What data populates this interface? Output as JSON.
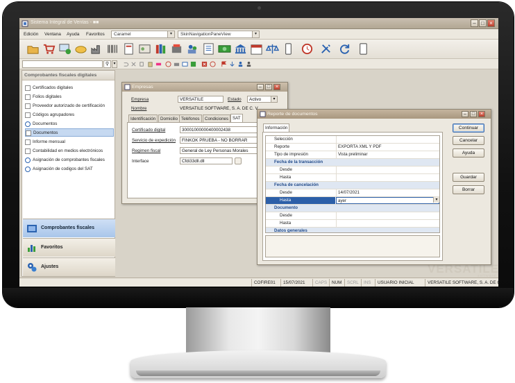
{
  "app": {
    "title": "Sistema Integral de Ventas - ■■"
  },
  "menu": {
    "items": [
      "Edición",
      "Ventana",
      "Ayuda",
      "Favoritos"
    ],
    "skin_combo": "Caramel",
    "layout_combo": "SkinNavigationPaneView"
  },
  "left_panel": {
    "header": "Comprobantes fiscales digitales",
    "items": [
      {
        "label": "Certificados digitales",
        "icon": "document-icon"
      },
      {
        "label": "Folios digitales",
        "icon": "document-icon"
      },
      {
        "label": "Proveedor autorizado de certificación",
        "icon": "document-icon"
      },
      {
        "label": "Códigos agrupadores",
        "icon": "document-icon"
      },
      {
        "label": "Documentos",
        "icon": "search-icon"
      },
      {
        "label": "Documentos",
        "icon": "document-icon"
      },
      {
        "label": "Informe mensual",
        "icon": "document-icon"
      },
      {
        "label": "Contabilidad en medios electrónicos",
        "icon": "document-icon"
      },
      {
        "label": "Asignación de comprobantes fiscales",
        "icon": "gear-icon"
      },
      {
        "label": "Asignación de codigos del SAT",
        "icon": "gear-icon"
      }
    ],
    "nav": [
      {
        "label": "Comprobantes fiscales digitales",
        "icon": "folder-icon"
      },
      {
        "label": "Favoritos",
        "icon": "chart-icon"
      },
      {
        "label": "Ajustes",
        "icon": "gear-icon"
      }
    ]
  },
  "status": {
    "code": "COFIRE01",
    "date": "15/07/2021",
    "caps": "CAPS",
    "num": "NUM",
    "scrl": "SCRL",
    "ins": "INS",
    "user": "USUARIO INICIAL",
    "company": "VERSATILE SOFTWARE, S. A. DE C. V."
  },
  "watermark": {
    "brand": "VERSATILE",
    "sub": "software"
  },
  "empresas": {
    "title": "Empresas",
    "empresa_label": "Empresa",
    "empresa_value": "VERSATILE",
    "estado_label": "Estado",
    "estado_value": "Activo",
    "nombre_label": "Nombre",
    "nombre_value": "VERSATILE SOFTWARE, S. A. DE C. V.",
    "tabs": [
      "Identificación",
      "Domicilio",
      "Teléfonos",
      "Condiciones",
      "SAT"
    ],
    "cert_label": "Certificado digital",
    "cert_value": "30001000000400002438",
    "servicio_label": "Servicio de expedición",
    "servicio_value": "FINKOK PRUEBA - NO BORRAR",
    "regimen_label": "Regimen fiscal",
    "regimen_value": "General de Ley Personas Morales",
    "interface_label": "Interface",
    "interface_value": "Cfdi33dll.dll"
  },
  "reporte": {
    "title": "Reporte de documentos",
    "tab": "Información",
    "rows": [
      {
        "type": "row",
        "label": "Selección",
        "value": ""
      },
      {
        "type": "row",
        "label": "Reporte",
        "value": "EXPORTA XML Y PDF"
      },
      {
        "type": "row",
        "label": "Tipo de impresión",
        "value": "Vista preliminar"
      },
      {
        "type": "cat",
        "label": "Fecha de la transacción",
        "value": ""
      },
      {
        "type": "sub",
        "label": "Desde",
        "value": ""
      },
      {
        "type": "sub",
        "label": "Hasta",
        "value": ""
      },
      {
        "type": "cat",
        "label": "Fecha de cancelación",
        "value": ""
      },
      {
        "type": "sub",
        "label": "Desde",
        "value": "14/07/2021"
      },
      {
        "type": "sel",
        "label": "Hasta",
        "value": "ayer"
      },
      {
        "type": "cat",
        "label": "Documento",
        "value": ""
      },
      {
        "type": "sub",
        "label": "Desde",
        "value": ""
      },
      {
        "type": "sub",
        "label": "Hasta",
        "value": ""
      },
      {
        "type": "cat",
        "label": "Datos generales",
        "value": ""
      }
    ],
    "buttons": {
      "continuar": "Continuar",
      "cancelar": "Cancelar",
      "ayuda": "Ayuda",
      "guardar": "Guardar",
      "borrar": "Borrar"
    }
  },
  "colors": {
    "accent": "#2c5fa8",
    "chrome": "#ece8df",
    "close": "#b9402e"
  }
}
